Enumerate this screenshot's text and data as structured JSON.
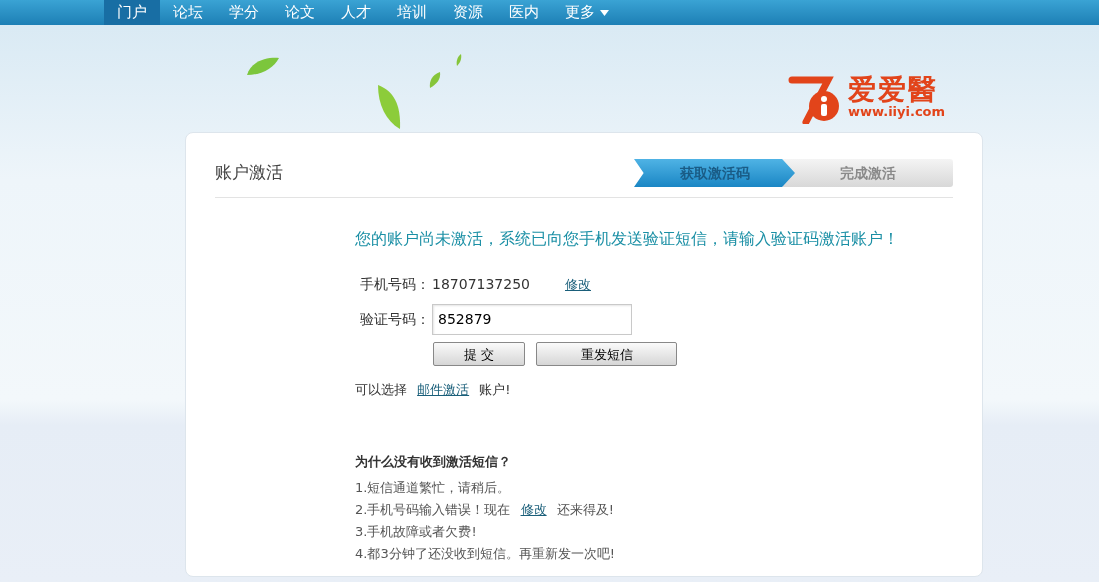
{
  "nav": [
    {
      "label": "门户",
      "selected": true
    },
    {
      "label": "论坛",
      "selected": false
    },
    {
      "label": "学分",
      "selected": false
    },
    {
      "label": "论文",
      "selected": false
    },
    {
      "label": "人才",
      "selected": false
    },
    {
      "label": "培训",
      "selected": false
    },
    {
      "label": "资源",
      "selected": false
    },
    {
      "label": "医内",
      "selected": false
    },
    {
      "label": "更多",
      "selected": false,
      "dropdown": true
    }
  ],
  "logo": {
    "name": "爱爱醫",
    "url": "www.iiyi.com"
  },
  "card": {
    "title": "账户激活",
    "steps": [
      {
        "label": "获取激活码",
        "selected": true
      },
      {
        "label": "完成激活",
        "selected": false
      }
    ],
    "message": "您的账户尚未激活，系统已向您手机发送验证短信，请输入验证码激活账户！",
    "phone": {
      "label": "手机号码：",
      "value": "18707137250",
      "link": "修改"
    },
    "code": {
      "label": "验证号码：",
      "value": "852879"
    },
    "buttons": [
      "提 交",
      "重发短信"
    ],
    "alternative": {
      "before": "可以选择",
      "link": "邮件激活",
      "after": "账户!"
    },
    "help": {
      "title": "为什么没有收到激活短信？",
      "items": [
        {
          "before": "1.短信通道繁忙，请稍后。"
        },
        {
          "before": "2.手机号码输入错误！现在",
          "link": "修改",
          "after": "还来得及!"
        },
        {
          "before": "3.手机故障或者欠费!"
        },
        {
          "before": "4.都3分钟了还没收到短信。再重新发一次吧!"
        }
      ]
    }
  }
}
